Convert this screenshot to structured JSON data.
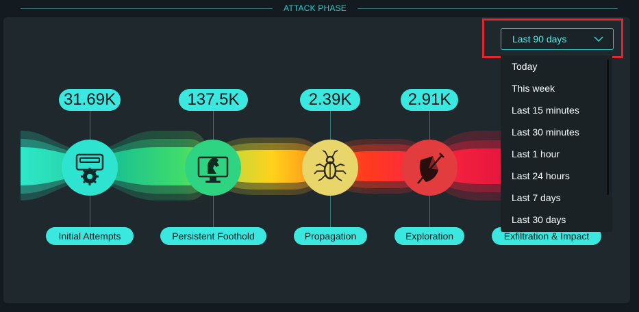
{
  "header": {
    "title": "ATTACK PHASE"
  },
  "stages": [
    {
      "value": "31.69K",
      "label": "Initial Attempts",
      "icon": "keyboard-gear-icon",
      "color": "#2ee3cf"
    },
    {
      "value": "137.5K",
      "label": "Persistent Foothold",
      "icon": "trojan-horse-monitor-icon",
      "color": "#2fd483"
    },
    {
      "value": "2.39K",
      "label": "Propagation",
      "icon": "bug-circuit-icon",
      "color": "#e9d66a"
    },
    {
      "value": "2.91K",
      "label": "Exploration",
      "icon": "shield-sword-icon",
      "color": "#e33c3f"
    },
    {
      "value": "",
      "label": "Exfiltration & Impact",
      "icon": "",
      "color": "#e0194e"
    }
  ],
  "dropdown": {
    "selected": "Last 90 days",
    "options": [
      "Today",
      "This week",
      "Last 15 minutes",
      "Last 30 minutes",
      "Last 1 hour",
      "Last 24 hours",
      "Last 7 days",
      "Last 30 days"
    ]
  }
}
